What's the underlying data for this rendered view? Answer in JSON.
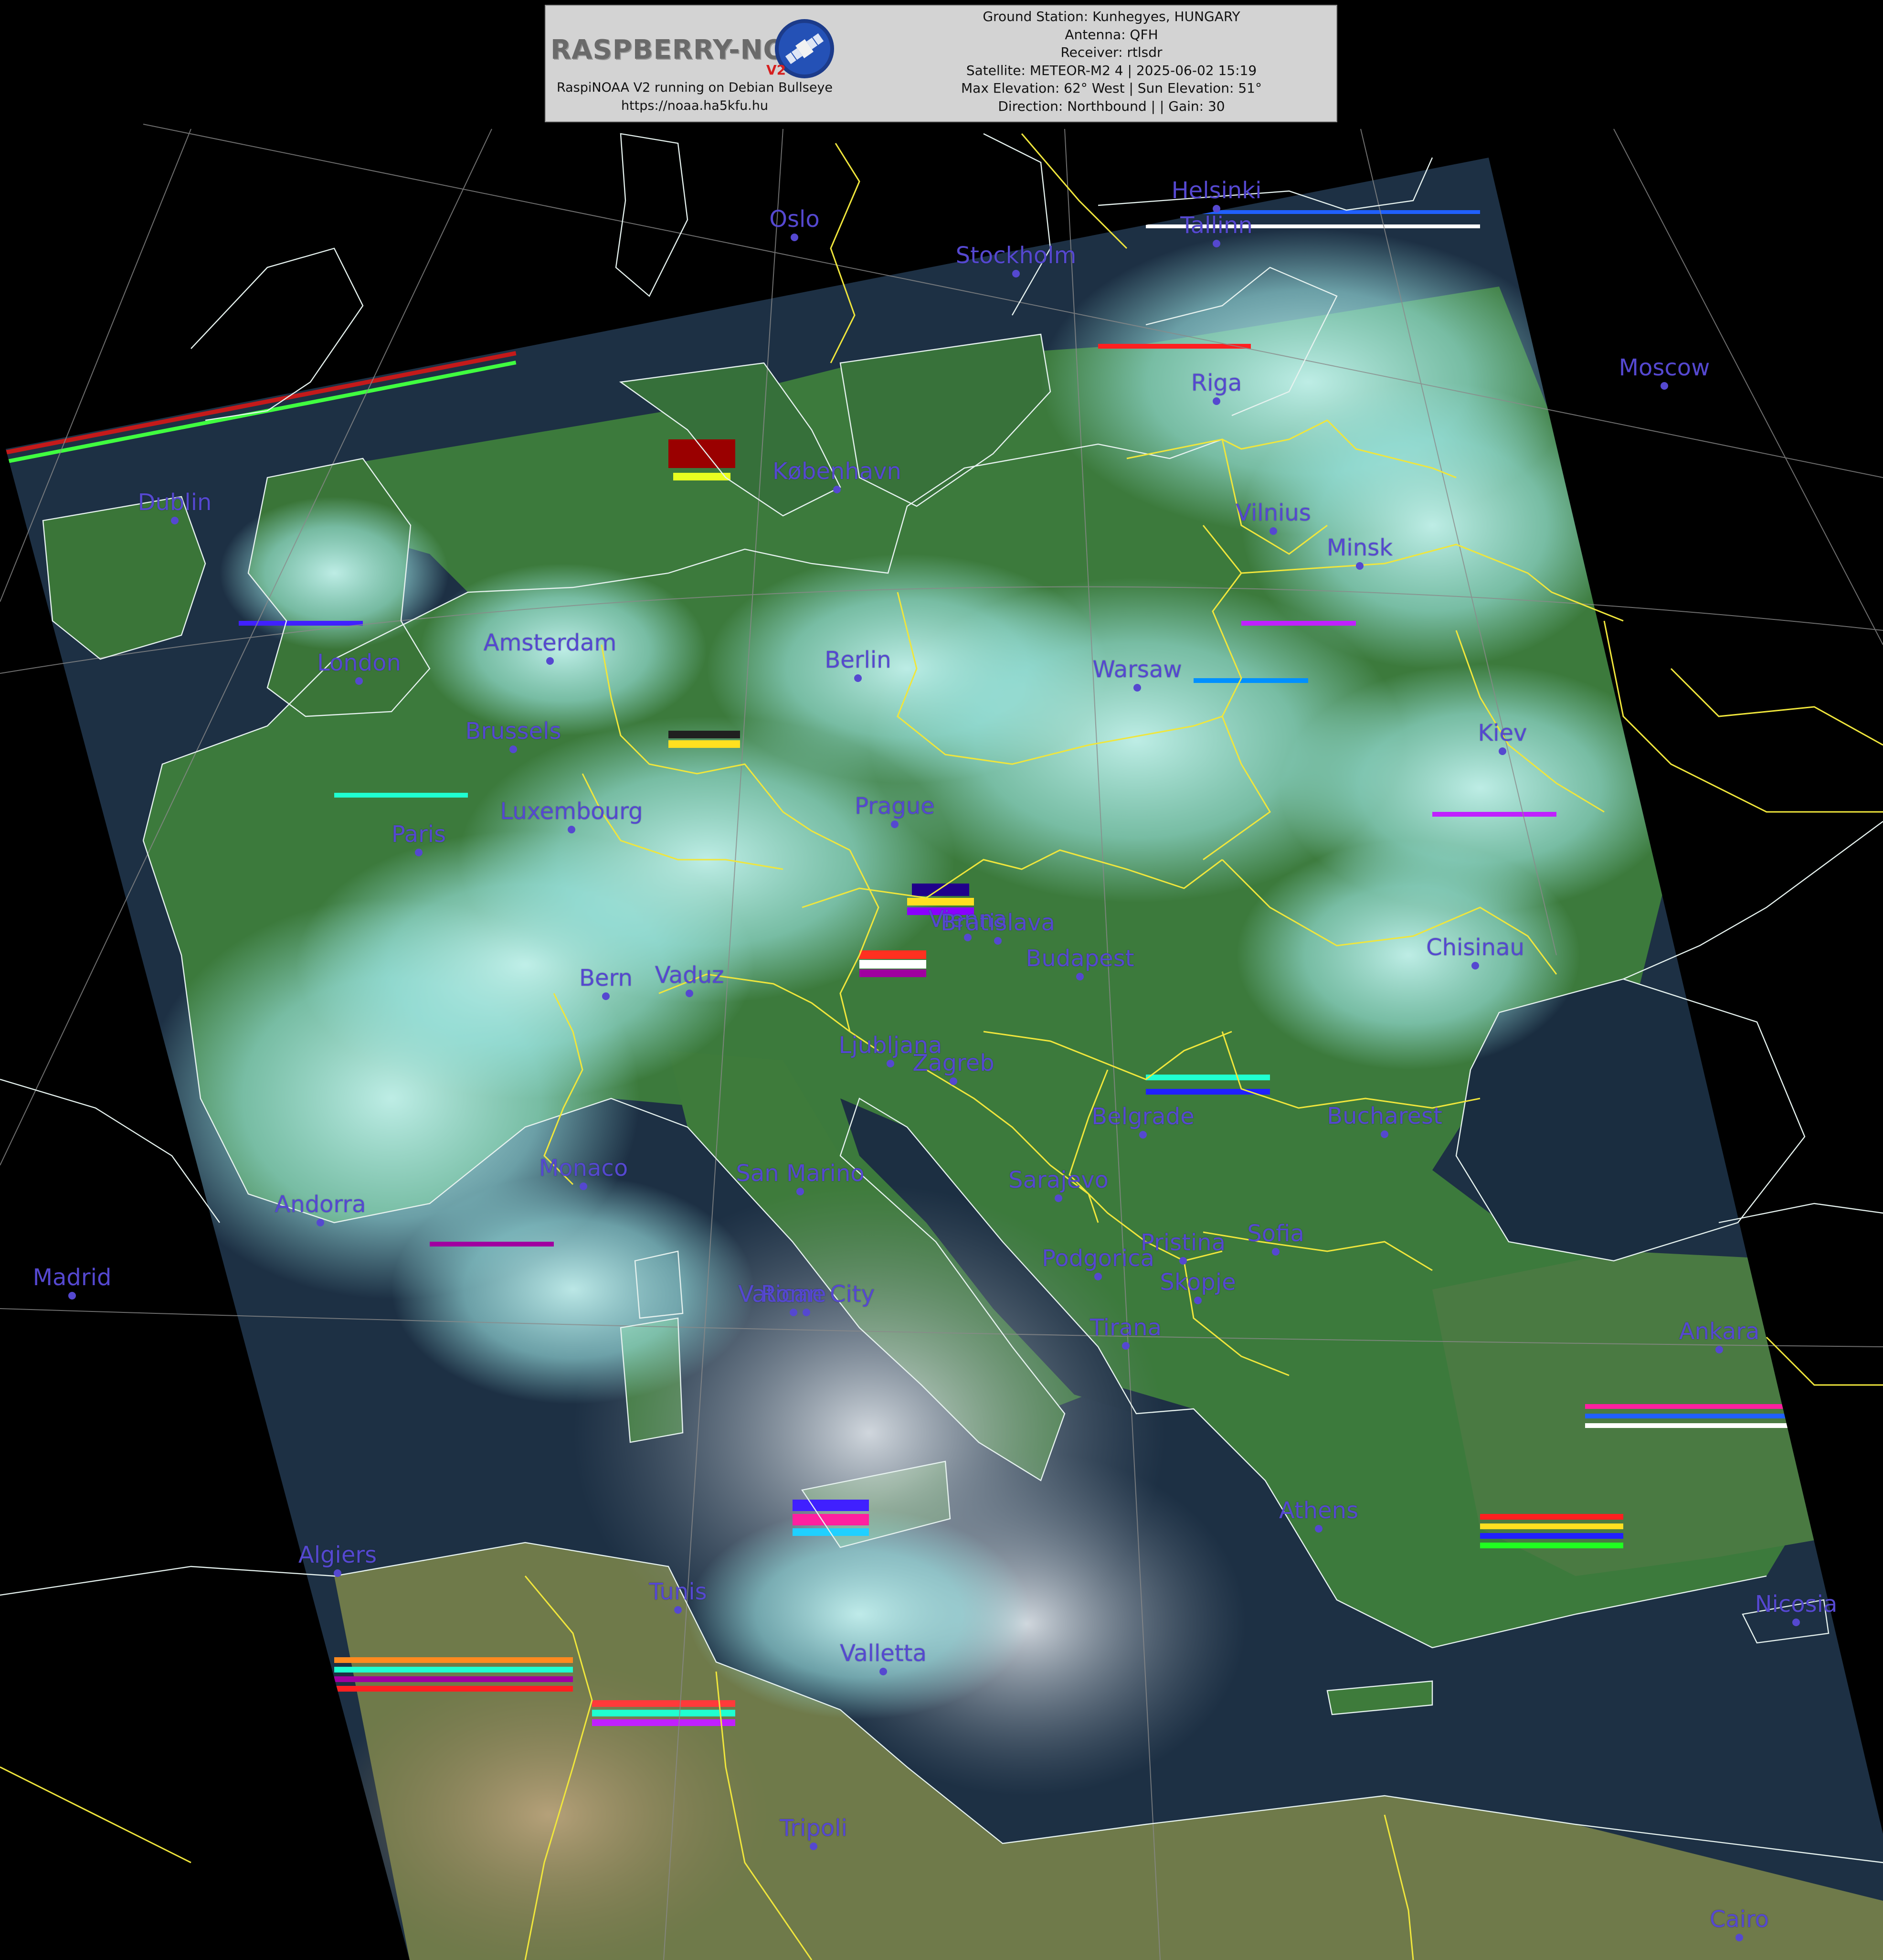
{
  "header": {
    "logo_text": "RASPBERRY-NOAA",
    "logo_version": "V2",
    "system_line": "RaspiNOAA V2 running on Debian Bullseye",
    "url_line": "https://noaa.ha5kfu.hu",
    "info_lines": [
      "Ground Station: Kunhegyes, HUNGARY",
      "Antenna: QFH",
      "Receiver: rtlsdr",
      "Satellite: METEOR-M2 4 | 2025-06-02 15:19",
      "Max Elevation: 62° West | Sun Elevation: 51°",
      "Direction: Northbound | | Gain: 30"
    ]
  },
  "colors": {
    "background": "#000000",
    "header_panel": "#d3d3d3",
    "city_label": "#5548d0",
    "border_lines": "#f0e63c",
    "coastlines": "#e6f2ef",
    "graticule": "#8a8a8a",
    "land": "#3c7a3c",
    "sea": "#1d3044",
    "cloud": "#a8f2f0"
  },
  "cities": [
    {
      "name": "Oslo"
    },
    {
      "name": "Helsinki"
    },
    {
      "name": "Tallinn"
    },
    {
      "name": "Stockholm"
    },
    {
      "name": "Moscow"
    },
    {
      "name": "Riga"
    },
    {
      "name": "København"
    },
    {
      "name": "Dublin"
    },
    {
      "name": "Vilnius"
    },
    {
      "name": "Minsk"
    },
    {
      "name": "London"
    },
    {
      "name": "Amsterdam"
    },
    {
      "name": "Berlin"
    },
    {
      "name": "Warsaw"
    },
    {
      "name": "Brussels"
    },
    {
      "name": "Kiev"
    },
    {
      "name": "Luxembourg"
    },
    {
      "name": "Prague"
    },
    {
      "name": "Paris"
    },
    {
      "name": "Vienna"
    },
    {
      "name": "Bratislava"
    },
    {
      "name": "Chisinau"
    },
    {
      "name": "Budapest"
    },
    {
      "name": "Bern"
    },
    {
      "name": "Vaduz"
    },
    {
      "name": "Ljubljana"
    },
    {
      "name": "Zagreb"
    },
    {
      "name": "Belgrade"
    },
    {
      "name": "Bucharest"
    },
    {
      "name": "Monaco"
    },
    {
      "name": "San Marino"
    },
    {
      "name": "Sarajevo"
    },
    {
      "name": "Andorra"
    },
    {
      "name": "Pristina"
    },
    {
      "name": "Sofia"
    },
    {
      "name": "Madrid"
    },
    {
      "name": "Podgorica"
    },
    {
      "name": "Skopje"
    },
    {
      "name": "Vatican City"
    },
    {
      "name": "Rome"
    },
    {
      "name": "Tirana"
    },
    {
      "name": "Ankara"
    },
    {
      "name": "Athens"
    },
    {
      "name": "Algiers"
    },
    {
      "name": "Tunis"
    },
    {
      "name": "Nicosia"
    },
    {
      "name": "Valletta"
    },
    {
      "name": "Tripoli"
    },
    {
      "name": "Cairo"
    }
  ]
}
